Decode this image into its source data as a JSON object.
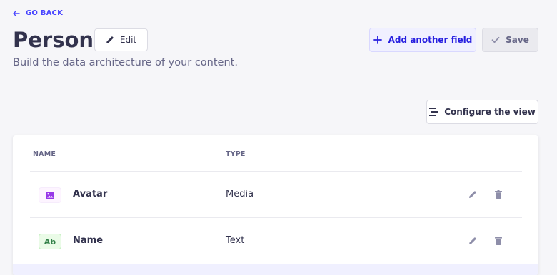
{
  "nav": {
    "back_label": "GO BACK"
  },
  "header": {
    "title": "Person",
    "edit_label": "Edit",
    "subtitle": "Build the data architecture of your content.",
    "add_field_label": "Add another field",
    "save_label": "Save"
  },
  "toolbar": {
    "configure_label": "Configure the view"
  },
  "table": {
    "columns": [
      "NAME",
      "TYPE"
    ],
    "rows": [
      {
        "name": "Avatar",
        "type": "Media",
        "icon": "image-icon",
        "badge": ""
      },
      {
        "name": "Name",
        "type": "Text",
        "icon": "text-ab-icon",
        "badge": "Ab"
      }
    ]
  },
  "colors": {
    "primary": "#4945ff",
    "background": "#f6f6f9",
    "text": "#32324d",
    "muted": "#666687",
    "media_badge": "#9736e8",
    "text_badge": "#328048"
  }
}
